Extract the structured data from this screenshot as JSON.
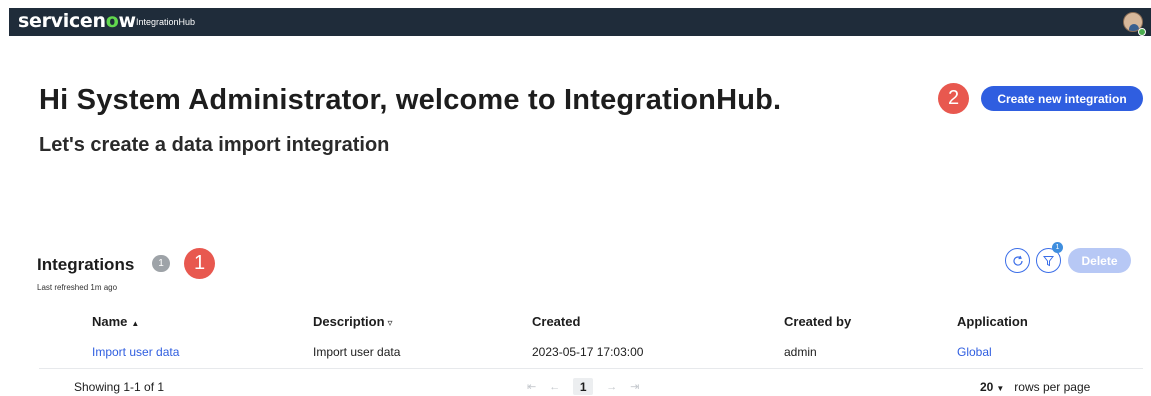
{
  "header": {
    "logo_text_1": "servicen",
    "logo_text_o": "o",
    "logo_text_2": "w",
    "app_name": "IntegrationHub"
  },
  "welcome": {
    "title": "Hi System Administrator, welcome to IntegrationHub.",
    "subtitle": "Let's create a data import integration"
  },
  "actions": {
    "create_label": "Create new integration",
    "delete_label": "Delete",
    "filter_count": "1"
  },
  "callouts": {
    "one": "1",
    "two": "2"
  },
  "list": {
    "title": "Integrations",
    "count": "1",
    "refreshed": "Last refreshed 1m ago"
  },
  "table": {
    "columns": {
      "name": "Name",
      "description": "Description",
      "created": "Created",
      "created_by": "Created by",
      "application": "Application"
    },
    "rows": [
      {
        "name": "Import user data",
        "description": "Import user data",
        "created": "2023-05-17 17:03:00",
        "created_by": "admin",
        "application": "Global"
      }
    ]
  },
  "pagination": {
    "showing": "Showing 1-1 of 1",
    "current_page": "1",
    "rows_per_page_value": "20",
    "rows_per_page_label": "rows per page"
  },
  "colors": {
    "topbar": "#1f2c3a",
    "primary": "#2f5ee0",
    "callout": "#e8584f",
    "logo_accent": "#62d84e"
  }
}
